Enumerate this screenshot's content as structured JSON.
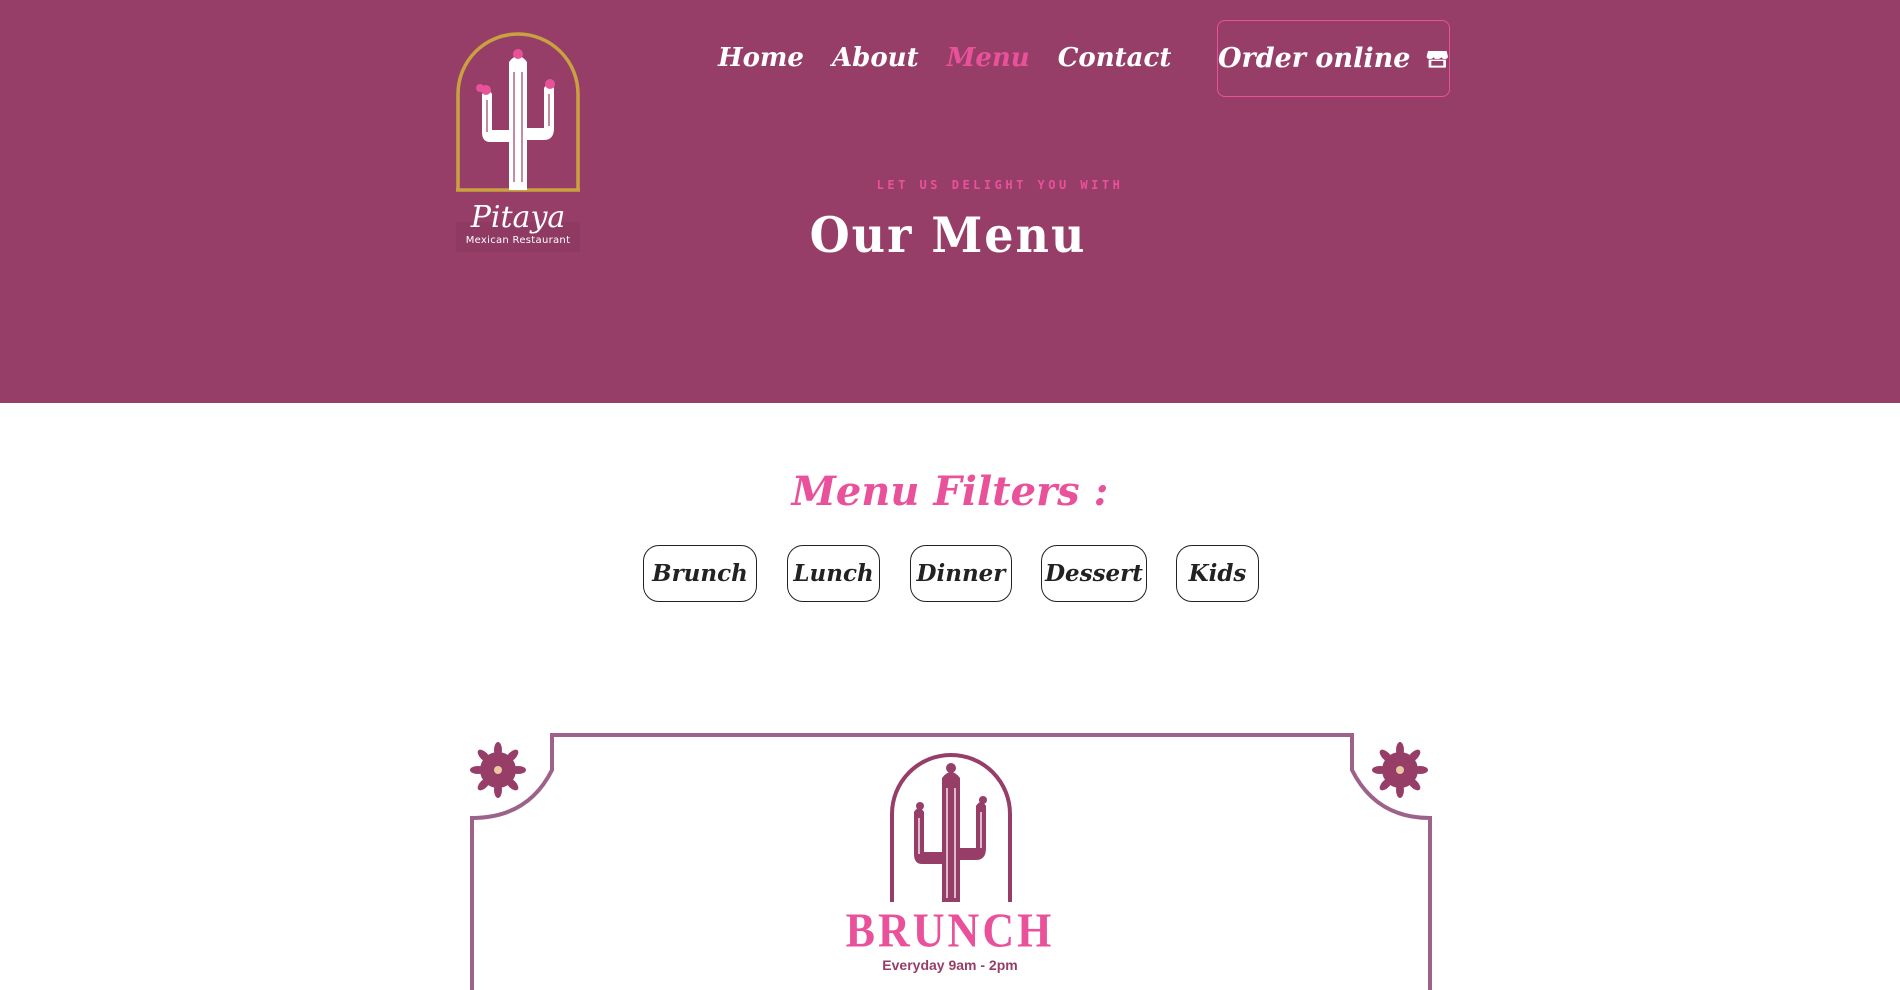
{
  "brand": {
    "name": "Pitaya",
    "tagline": "Mexican Restaurant",
    "colors": {
      "primary": "#973e68",
      "accent": "#e9519a",
      "gold": "#c9a240",
      "white": "#ffffff"
    }
  },
  "nav": {
    "items": [
      {
        "label": "Home",
        "active": false
      },
      {
        "label": "About",
        "active": false
      },
      {
        "label": "Menu",
        "active": true
      },
      {
        "label": "Contact",
        "active": false
      }
    ],
    "order_button": {
      "label": "Order online",
      "icon": "storefront-icon"
    }
  },
  "hero": {
    "eyebrow": "LET US DELIGHT YOU WITH",
    "title": "Our Menu"
  },
  "filters": {
    "title": "Menu Filters :",
    "options": [
      "Brunch",
      "Lunch",
      "Dinner",
      "Dessert",
      "Kids"
    ]
  },
  "menu_section": {
    "title": "BRUNCH",
    "hours": "Everyday 9am - 2pm",
    "icons": [
      "cactus-icon",
      "flower-icon"
    ]
  }
}
